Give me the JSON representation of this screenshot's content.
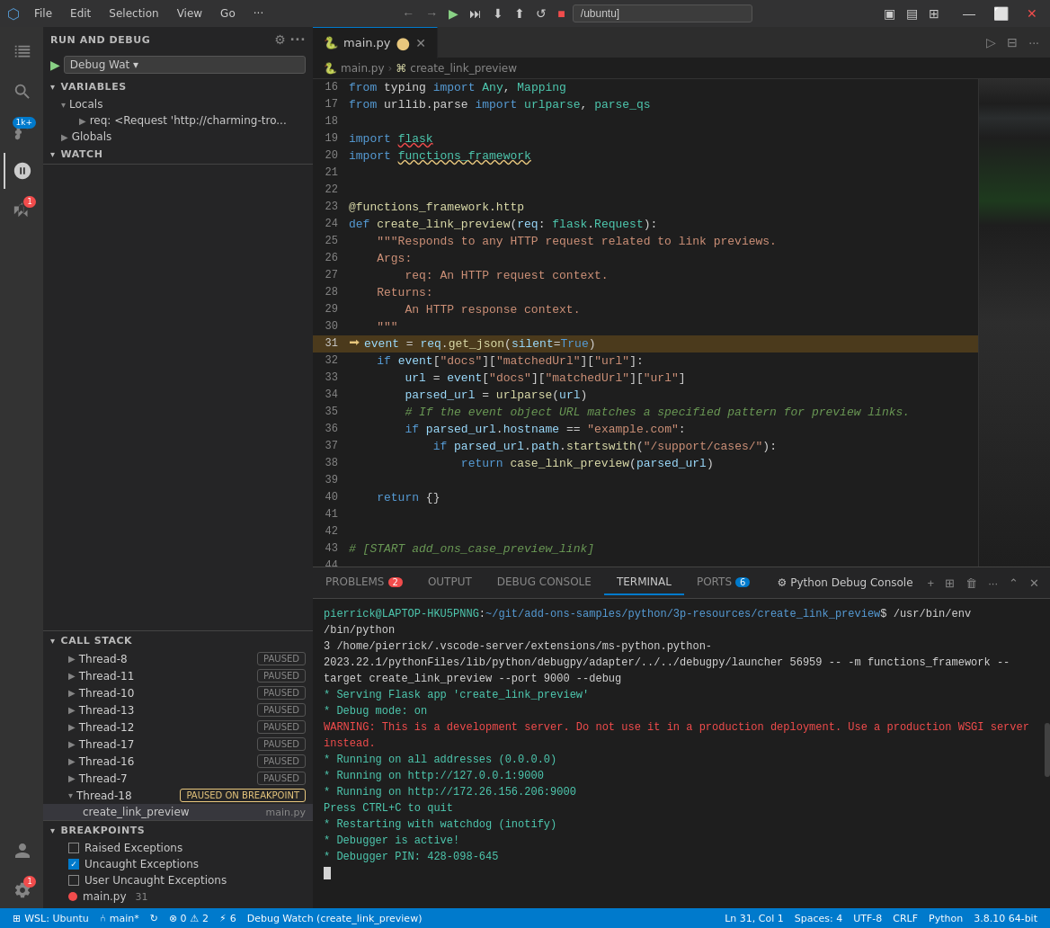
{
  "titlebar": {
    "icon": "⬡",
    "menu": [
      "File",
      "Edit",
      "Selection",
      "View",
      "Go",
      "···"
    ],
    "nav_back": "←",
    "nav_forward": "→",
    "search_placeholder": "",
    "debug_controls": [
      "▶",
      "⏭",
      "⏬",
      "⏫",
      "↺",
      "■",
      "⬛"
    ],
    "debug_target": "/ubuntu]",
    "layout_btns": [
      "▣",
      "▤",
      "▦"
    ],
    "window_controls": [
      "—",
      "⬜",
      "✕"
    ]
  },
  "activity_bar": {
    "items": [
      {
        "icon": "⬡",
        "name": "explorer",
        "active": false
      },
      {
        "icon": "🔍",
        "name": "search",
        "active": false
      },
      {
        "icon": "⑃",
        "name": "source-control",
        "badge": "1k+",
        "active": false
      },
      {
        "icon": "▶",
        "name": "run-debug",
        "active": true
      },
      {
        "icon": "⚙",
        "name": "extensions",
        "badge": "1",
        "active": false
      },
      {
        "icon": "⬡",
        "name": "remote",
        "active": false
      },
      {
        "icon": "⚗",
        "name": "testing",
        "active": false
      }
    ],
    "bottom": [
      {
        "icon": "👤",
        "name": "account"
      },
      {
        "icon": "⚙",
        "name": "settings",
        "badge": "1"
      }
    ]
  },
  "sidebar": {
    "run_debug_header": "RUN AND DEBUG",
    "debug_play_btn": "▶",
    "debug_config": "Debug Wat",
    "gear_btn": "⚙",
    "more_btn": "···",
    "variables_header": "VARIABLES",
    "locals_label": "Locals",
    "locals_items": [
      {
        "label": "req: <Request 'http://charming-tro..."
      }
    ],
    "globals_label": "Globals",
    "watch_header": "WATCH",
    "call_stack_header": "CALL STACK",
    "call_stack_threads": [
      {
        "name": "Thread-8",
        "status": "PAUSED",
        "expanded": false
      },
      {
        "name": "Thread-11",
        "status": "PAUSED",
        "expanded": false
      },
      {
        "name": "Thread-10",
        "status": "PAUSED",
        "expanded": false
      },
      {
        "name": "Thread-13",
        "status": "PAUSED",
        "expanded": false
      },
      {
        "name": "Thread-12",
        "status": "PAUSED",
        "expanded": false
      },
      {
        "name": "Thread-17",
        "status": "PAUSED",
        "expanded": false
      },
      {
        "name": "Thread-16",
        "status": "PAUSED",
        "expanded": false
      },
      {
        "name": "Thread-7",
        "status": "PAUSED",
        "expanded": false
      },
      {
        "name": "Thread-18",
        "status": "PAUSED ON BREAKPOINT",
        "expanded": true
      }
    ],
    "call_stack_func": "create_link_preview",
    "call_stack_file": "main.py",
    "breakpoints_header": "BREAKPOINTS",
    "breakpoints": [
      {
        "label": "Raised Exceptions",
        "checked": false
      },
      {
        "label": "Uncaught Exceptions",
        "checked": true
      },
      {
        "label": "User Uncaught Exceptions",
        "checked": false
      },
      {
        "label": "main.py",
        "checked": true,
        "dot": true,
        "linenum": "31"
      }
    ]
  },
  "editor": {
    "tab_name": "main.py",
    "tab_modified": true,
    "tab_num": "2",
    "breadcrumb": [
      "main.py",
      "create_link_preview"
    ],
    "lines": [
      {
        "num": 16,
        "code": "from typing import Any, Mapping"
      },
      {
        "num": 17,
        "code": "from urllib.parse import urlparse, parse_qs"
      },
      {
        "num": 18,
        "code": ""
      },
      {
        "num": 19,
        "code": "import flask"
      },
      {
        "num": 20,
        "code": "import functions_framework"
      },
      {
        "num": 21,
        "code": ""
      },
      {
        "num": 22,
        "code": ""
      },
      {
        "num": 23,
        "code": "@functions_framework.http"
      },
      {
        "num": 24,
        "code": "def create_link_preview(req: flask.Request):"
      },
      {
        "num": 25,
        "code": "    \"\"\"Responds to any HTTP request related to link previews."
      },
      {
        "num": 26,
        "code": "    Args:"
      },
      {
        "num": 27,
        "code": "        req: An HTTP request context."
      },
      {
        "num": 28,
        "code": "    Returns:"
      },
      {
        "num": 29,
        "code": "        An HTTP response context."
      },
      {
        "num": 30,
        "code": "    \"\"\""
      },
      {
        "num": 31,
        "code": "    event = req.get_json(silent=True)",
        "current": true
      },
      {
        "num": 32,
        "code": "    if event[\"docs\"][\"matchedUrl\"][\"url\"]:"
      },
      {
        "num": 33,
        "code": "        url = event[\"docs\"][\"matchedUrl\"][\"url\"]"
      },
      {
        "num": 34,
        "code": "        parsed_url = urlparse(url)"
      },
      {
        "num": 35,
        "code": "        # If the event object URL matches a specified pattern for preview links."
      },
      {
        "num": 36,
        "code": "        if parsed_url.hostname == \"example.com\":"
      },
      {
        "num": 37,
        "code": "            if parsed_url.path.startswith(\"/support/cases/\"):"
      },
      {
        "num": 38,
        "code": "                return case_link_preview(parsed_url)"
      },
      {
        "num": 39,
        "code": ""
      },
      {
        "num": 40,
        "code": "    return {}"
      },
      {
        "num": 41,
        "code": ""
      },
      {
        "num": 42,
        "code": ""
      },
      {
        "num": 43,
        "code": "# [START add_ons_case_preview_link]"
      },
      {
        "num": 44,
        "code": ""
      }
    ]
  },
  "terminal": {
    "tabs": [
      {
        "label": "PROBLEMS",
        "badge": "2",
        "active": false
      },
      {
        "label": "OUTPUT",
        "badge": "",
        "active": false
      },
      {
        "label": "DEBUG CONSOLE",
        "badge": "",
        "active": false
      },
      {
        "label": "TERMINAL",
        "badge": "",
        "active": true
      },
      {
        "label": "PORTS",
        "badge": "6",
        "active": false
      }
    ],
    "python_console_label": "Python Debug Console",
    "content": [
      {
        "type": "prompt",
        "text": "pierrick@LAPTOP-HKU5PNNG:~/git/add-ons-samples/python/3p-resources/create_link_preview$ /usr/bin/env /bin/python3 /home/pierrick/.vscode-server/extensions/ms-python.python-2023.22.1/pythonFiles/lib/python/debugpy/adapter/../../debugpy/launcher 56959 -- -m functions_framework --target create_link_preview --port 9000 --debug"
      },
      {
        "type": "info",
        "text": " * Serving Flask app 'create_link_preview'"
      },
      {
        "type": "info",
        "text": " * Debug mode: on"
      },
      {
        "type": "warning",
        "text": "WARNING: This is a development server. Do not use it in a production deployment. Use a production WSGI server instead."
      },
      {
        "type": "info",
        "text": " * Running on all addresses (0.0.0.0)"
      },
      {
        "type": "info",
        "text": " * Running on http://127.0.0.1:9000"
      },
      {
        "type": "info",
        "text": " * Running on http://172.26.156.206:9000"
      },
      {
        "type": "info",
        "text": "Press CTRL+C to quit"
      },
      {
        "type": "info",
        "text": " * Restarting with watchdog (inotify)"
      },
      {
        "type": "info",
        "text": " * Debugger is active!"
      },
      {
        "type": "info",
        "text": " * Debugger PIN: 428-098-645"
      }
    ]
  },
  "statusbar": {
    "remote": "⊞ WSL: Ubuntu",
    "git_branch": "main*",
    "sync": "↻",
    "errors": "⊗ 0",
    "warnings": "⚠ 2",
    "debug": "⚡ 6",
    "debug_label": "Debug Watch (create_link_preview)",
    "position": "Ln 31, Col 1",
    "spaces": "Spaces: 4",
    "encoding": "UTF-8",
    "eol": "CRLF",
    "language": "Python",
    "python_version": "3.8.10 64-bit"
  }
}
